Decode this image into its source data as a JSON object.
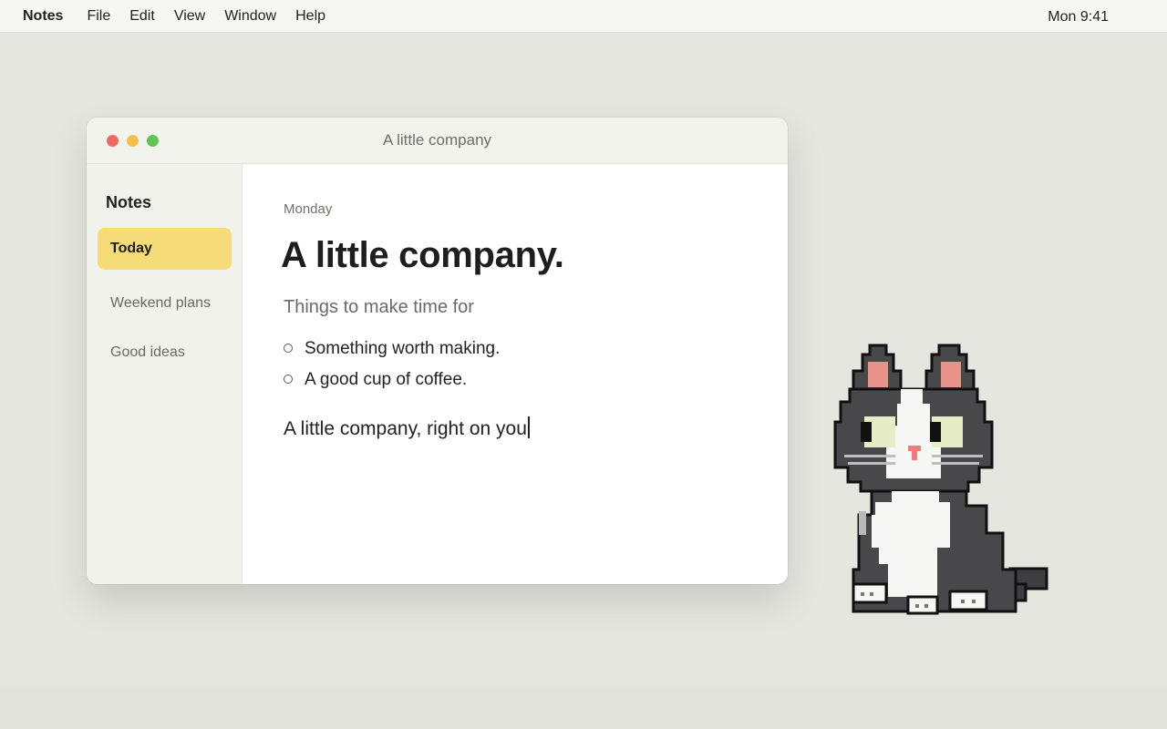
{
  "menubar": {
    "app_name": "Notes",
    "menus": [
      "File",
      "Edit",
      "View",
      "Window",
      "Help"
    ],
    "clock": "Mon 9:41"
  },
  "window": {
    "title": "A little company"
  },
  "sidebar": {
    "heading": "Notes",
    "items": [
      {
        "label": "Today",
        "selected": true
      },
      {
        "label": "Weekend plans",
        "selected": false
      },
      {
        "label": "Good ideas",
        "selected": false
      }
    ]
  },
  "note": {
    "date": "Monday",
    "title": "A little company.",
    "subtitle": "Things to make time for",
    "checklist": [
      {
        "text": "Something worth making.",
        "checked": false
      },
      {
        "text": "A good cup of coffee.",
        "checked": false
      }
    ],
    "body": "A little company, right on you"
  },
  "colors": {
    "desktop": "#e6e6e0",
    "accent_selected": "#f5dc78",
    "traffic_red": "#ec6a5e",
    "traffic_yellow": "#f4bf4f",
    "traffic_green": "#61c554"
  },
  "icons": {
    "cat": "pixel-cat-icon"
  }
}
